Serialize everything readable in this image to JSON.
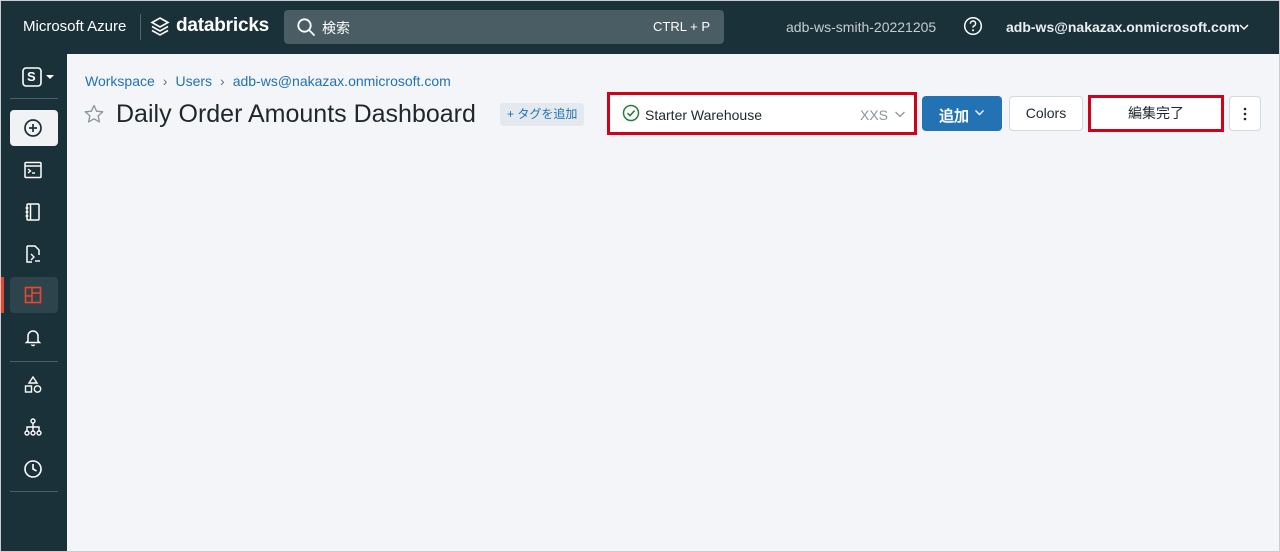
{
  "topbar": {
    "brand_azure": "Microsoft Azure",
    "brand_databricks": "databricks",
    "search": {
      "placeholder": "検索",
      "shortcut": "CTRL + P"
    },
    "workspace": "adb-ws-smith-20221205",
    "user": "adb-ws@nakazax.onmicrosoft.com"
  },
  "sidebar": {
    "persona_letter": "S",
    "items": [
      {
        "name": "new",
        "icon": "plus-circle-icon"
      },
      {
        "name": "sql-editor",
        "icon": "terminal-window-icon"
      },
      {
        "name": "queries",
        "icon": "notebook-icon"
      },
      {
        "name": "query-file",
        "icon": "file-code-icon"
      },
      {
        "name": "dashboards",
        "icon": "dashboard-icon",
        "active": true
      },
      {
        "name": "alerts",
        "icon": "bell-icon"
      },
      {
        "name": "data",
        "icon": "shapes-icon"
      },
      {
        "name": "workflows",
        "icon": "hierarchy-icon"
      },
      {
        "name": "history",
        "icon": "clock-icon"
      }
    ]
  },
  "breadcrumb": [
    "Workspace",
    "Users",
    "adb-ws@nakazax.onmicrosoft.com"
  ],
  "page": {
    "title": "Daily Order Amounts Dashboard",
    "tag_button": "+ タグを追加"
  },
  "toolbar": {
    "warehouse_name": "Starter Warehouse",
    "warehouse_size": "XXS",
    "add_label": "追加",
    "colors_label": "Colors",
    "done_label": "編集完了"
  },
  "colors": {
    "topbar_bg": "#1b3139",
    "primary": "#2272b4",
    "highlight": "#d0021b",
    "active_accent": "#e8462f"
  }
}
